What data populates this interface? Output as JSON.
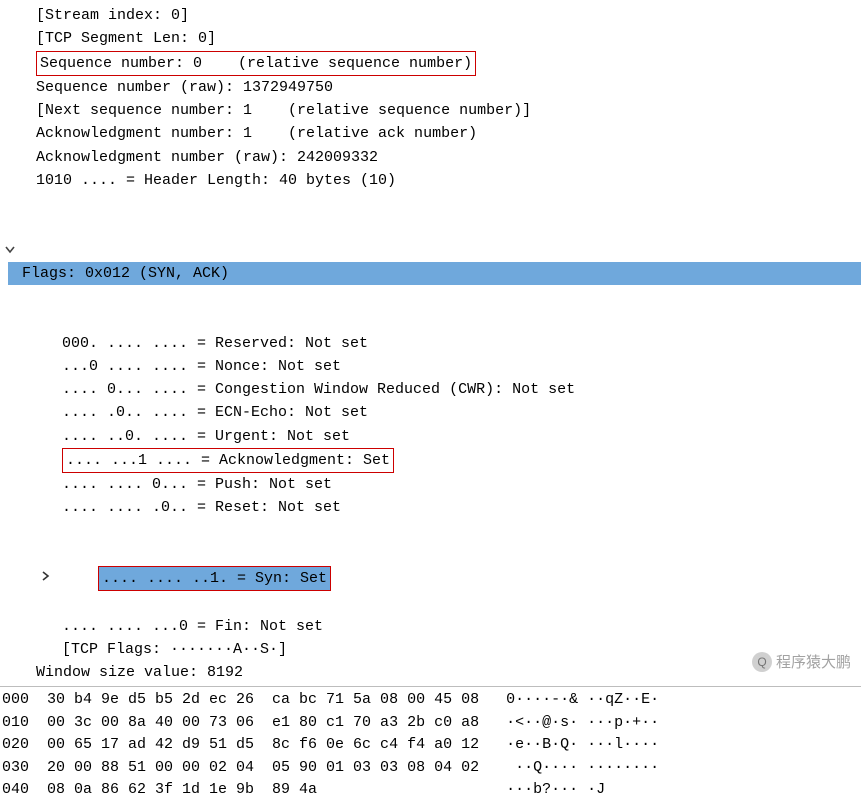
{
  "packet": {
    "stream_index": "[Stream index: 0]",
    "tcp_seg_len": "[TCP Segment Len: 0]",
    "seq_rel": "Sequence number: 0    (relative sequence number)",
    "seq_raw": "Sequence number (raw): 1372949750",
    "next_seq": "[Next sequence number: 1    (relative sequence number)]",
    "ack_rel": "Acknowledgment number: 1    (relative ack number)",
    "ack_raw": "Acknowledgment number (raw): 242009332",
    "hdr_len": "1010 .... = Header Length: 40 bytes (10)",
    "flags_summary": "Flags: 0x012 (SYN, ACK)",
    "flags": {
      "reserved": "000. .... .... = Reserved: Not set",
      "nonce": "...0 .... .... = Nonce: Not set",
      "cwr": ".... 0... .... = Congestion Window Reduced (CWR): Not set",
      "ecn": ".... .0.. .... = ECN-Echo: Not set",
      "urg": ".... ..0. .... = Urgent: Not set",
      "ack": ".... ...1 .... = Acknowledgment: Set",
      "psh": ".... .... 0... = Push: Not set",
      "rst": ".... .... .0.. = Reset: Not set",
      "syn": ".... .... ..1. = Syn: Set",
      "fin": ".... .... ...0 = Fin: Not set",
      "tcp_flags": "[TCP Flags: ·······A··S·]"
    },
    "win": "Window size value: 8192"
  },
  "hex": {
    "rows": [
      {
        "off": "000",
        "b": "30 b4 9e d5 b5 2d ec 26  ca bc 71 5a 08 00 45 08",
        "a": "0····-·& ··qZ··E·"
      },
      {
        "off": "010",
        "b": "00 3c 00 8a 40 00 73 06  e1 80 c1 70 a3 2b c0 a8",
        "a": "·<··@·s· ···p·+··"
      },
      {
        "off": "020",
        "b": "00 65 17 ad 42 d9 51 d5  8c f6 0e 6c c4 f4 a0 12",
        "a": "·e··B·Q· ···l····"
      },
      {
        "off": "030",
        "b": "20 00 88 51 00 00 02 04  05 90 01 03 03 08 04 02",
        "a": " ··Q···· ········"
      },
      {
        "off": "040",
        "b": "08 0a 86 62 3f 1d 1e 9b  89 4a",
        "a": "···b?··· ·J"
      }
    ]
  },
  "watermark": "程序猿大鹏"
}
